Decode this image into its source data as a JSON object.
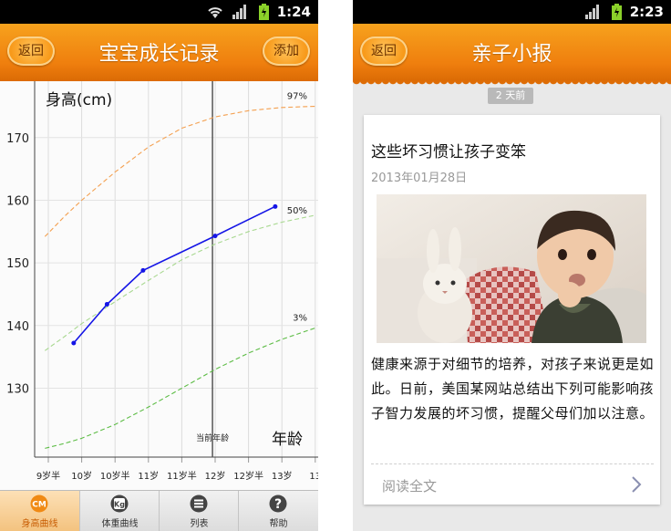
{
  "left": {
    "status_time": "1:24",
    "title": "宝宝成长记录",
    "back_label": "返回",
    "add_label": "添加",
    "tabs": [
      {
        "label": "身高曲线",
        "icon_text": "CM",
        "icon": "ruler-icon"
      },
      {
        "label": "体重曲线",
        "icon_text": "Kg",
        "icon": "scale-icon"
      },
      {
        "label": "列表",
        "icon": "list-icon"
      },
      {
        "label": "帮助",
        "icon": "help-icon"
      }
    ],
    "current_age_label": "当前年龄"
  },
  "right": {
    "status_time": "2:23",
    "title": "亲子小报",
    "back_label": "返回",
    "badge": "2 天前",
    "article": {
      "title": "这些坏习惯让孩子变笨",
      "date": "2013年01月28日",
      "body": "健康来源于对细节的培养，对孩子来说更是如此。日前，美国某网站总结出下列可能影响孩子智力发展的坏习惯，提醒父母们加以注意。",
      "read_more": "阅读全文"
    }
  },
  "chart_data": {
    "type": "line",
    "ylabel": "身高(cm)",
    "xlabel": "年龄",
    "y_ticks": [
      130,
      140,
      150,
      160,
      170
    ],
    "x_ticks": [
      "9岁半",
      "10岁",
      "10岁半",
      "11岁",
      "11岁半",
      "12岁",
      "12岁半",
      "13岁",
      "13"
    ],
    "x_tick_values": [
      9.5,
      10,
      10.5,
      11,
      11.5,
      12,
      12.5,
      13,
      13.5
    ],
    "current_age": 11.96,
    "series": [
      {
        "name": "97%",
        "style": "dashed",
        "color": "#f4a050",
        "x": [
          9.45,
          9.75,
          10.0,
          10.5,
          11.0,
          11.5,
          12.0,
          12.5,
          13.0,
          13.5
        ],
        "y": [
          154.2,
          157.5,
          160.0,
          164.5,
          168.5,
          171.5,
          173.3,
          174.3,
          174.8,
          175.0
        ]
      },
      {
        "name": "50%",
        "style": "dashed",
        "color": "#a8d890",
        "x": [
          9.45,
          9.75,
          10.0,
          10.5,
          11.0,
          11.5,
          12.0,
          12.5,
          13.0,
          13.5
        ],
        "y": [
          136.0,
          138.3,
          140.3,
          143.8,
          147.2,
          150.5,
          153.0,
          155.0,
          156.5,
          157.6
        ]
      },
      {
        "name": "3%",
        "style": "dashed",
        "color": "#5cbc44",
        "x": [
          9.45,
          9.75,
          10.0,
          10.5,
          11.0,
          11.5,
          12.0,
          12.5,
          13.0,
          13.5
        ],
        "y": [
          120.4,
          121.2,
          122.0,
          124.2,
          127.0,
          130.0,
          133.0,
          135.6,
          137.8,
          139.6
        ]
      },
      {
        "name": "",
        "style": "solid",
        "color": "#1414e6",
        "x": [
          9.88,
          10.38,
          10.92,
          12.0,
          12.9
        ],
        "y": [
          137.2,
          143.4,
          148.8,
          154.3,
          159.0
        ]
      }
    ],
    "ylim": [
      119,
      179
    ],
    "xlim": [
      9.25,
      13.5
    ],
    "grid": true
  },
  "colors": {
    "accent": "#f08a14",
    "title_text": "#ffffff"
  }
}
